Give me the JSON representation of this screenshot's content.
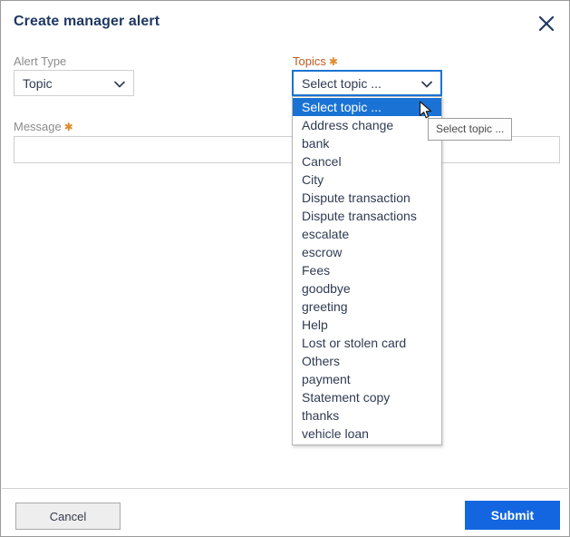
{
  "dialog": {
    "title": "Create manager alert",
    "close_icon": "close-icon"
  },
  "fields": {
    "alert_type": {
      "label": "Alert Type",
      "value": "Topic",
      "caret_icon": "chevron-down-icon"
    },
    "topics": {
      "label": "Topics",
      "required_marker": "✱",
      "value": "Select topic ...",
      "caret_icon": "chevron-down-icon",
      "options": [
        "Select topic ...",
        "Address change",
        "bank",
        "Cancel",
        "City",
        "Dispute transaction",
        "Dispute transactions",
        "escalate",
        "escrow",
        "Fees",
        "goodbye",
        "greeting",
        "Help",
        "Lost or stolen card",
        "Others",
        "payment",
        "Statement copy",
        "thanks",
        "vehicle loan"
      ],
      "selected_index": 0
    },
    "message": {
      "label": "Message",
      "required_marker": "✱",
      "value": "",
      "placeholder": ""
    }
  },
  "tooltip": {
    "text": "Select topic ..."
  },
  "footer": {
    "cancel_label": "Cancel",
    "submit_label": "Submit"
  },
  "colors": {
    "title": "#1f3864",
    "required_label": "#c05a21",
    "required_star": "#e08a2e",
    "focus_border": "#1a73d4",
    "option_highlight": "#1a73d4",
    "submit_bg": "#1366e0",
    "cancel_bg": "#eeeeee"
  }
}
